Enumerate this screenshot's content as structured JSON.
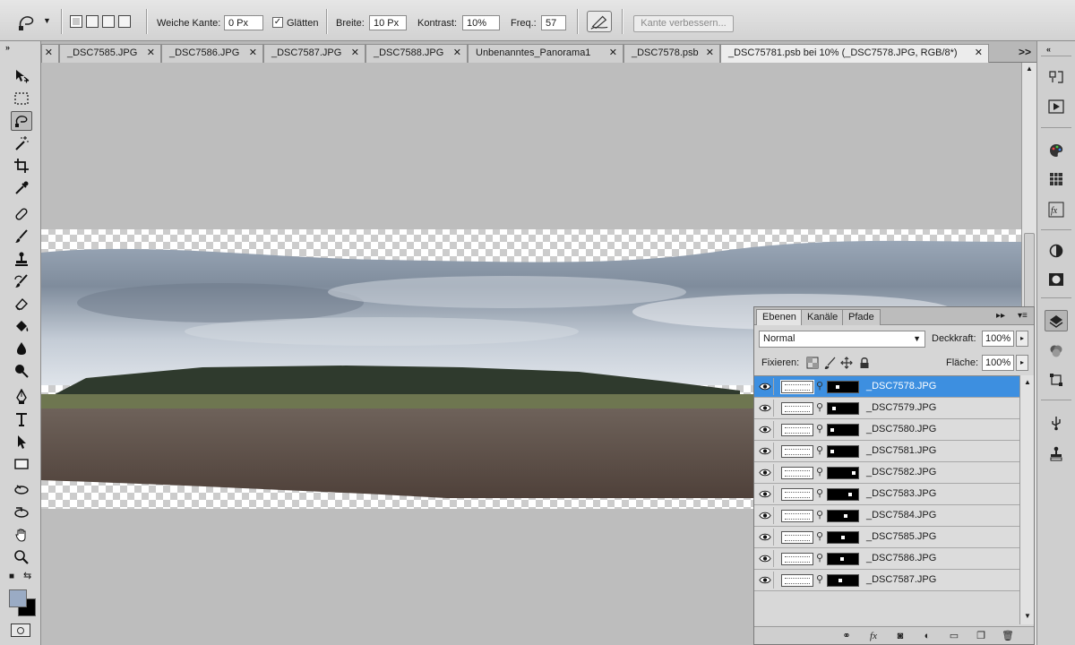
{
  "options_bar": {
    "weiche_kante_label": "Weiche Kante:",
    "weiche_kante_value": "0 Px",
    "glaetten_label": "Glätten",
    "glaetten_checked": true,
    "breite_label": "Breite:",
    "breite_value": "10 Px",
    "kontrast_label": "Kontrast:",
    "kontrast_value": "10%",
    "freq_label": "Freq.:",
    "freq_value": "57",
    "refine_edge_label": "Kante verbessern..."
  },
  "tabs": [
    {
      "label": "_DSC7585.JPG"
    },
    {
      "label": "_DSC7586.JPG"
    },
    {
      "label": "_DSC7587.JPG"
    },
    {
      "label": "_DSC7588.JPG"
    },
    {
      "label": "Unbenanntes_Panorama1"
    },
    {
      "label": "_DSC7578.psb"
    },
    {
      "label": "_DSC75781.psb bei 10% (_DSC7578.JPG, RGB/8*)",
      "active": true
    }
  ],
  "tab_more": ">>",
  "tools": [
    "move-icon",
    "marquee-icon",
    "magnetic-lasso-icon",
    "magic-wand-icon",
    "crop-icon",
    "eyedropper-icon",
    "healing-brush-icon",
    "brush-icon",
    "clone-stamp-icon",
    "history-brush-icon",
    "eraser-icon",
    "paint-bucket-icon",
    "blur-icon",
    "dodge-icon",
    "pen-icon",
    "type-icon",
    "path-selection-icon",
    "rectangle-icon",
    "3d-rotate-icon",
    "3d-orbit-icon",
    "hand-icon",
    "zoom-icon"
  ],
  "colors": {
    "foreground": "#9aabc4",
    "background": "#000000",
    "selection": "#3d8fe0"
  },
  "layers_panel": {
    "tabs": [
      "Ebenen",
      "Kanäle",
      "Pfade"
    ],
    "blend_mode": "Normal",
    "opacity_label": "Deckkraft:",
    "opacity_value": "100%",
    "lock_label": "Fixieren:",
    "fill_label": "Fläche:",
    "fill_value": "100%",
    "layers": [
      {
        "name": "_DSC7578.JPG",
        "selected": true,
        "mask_spot": 0.3
      },
      {
        "name": "_DSC7579.JPG",
        "mask_spot": 0.15
      },
      {
        "name": "_DSC7580.JPG",
        "mask_spot": 0.1
      },
      {
        "name": "_DSC7581.JPG",
        "mask_spot": 0.1
      },
      {
        "name": "_DSC7582.JPG",
        "mask_spot": 0.9
      },
      {
        "name": "_DSC7583.JPG",
        "mask_spot": 0.75
      },
      {
        "name": "_DSC7584.JPG",
        "mask_spot": 0.6
      },
      {
        "name": "_DSC7585.JPG",
        "mask_spot": 0.5
      },
      {
        "name": "_DSC7586.JPG",
        "mask_spot": 0.45
      },
      {
        "name": "_DSC7587.JPG",
        "mask_spot": 0.4
      }
    ]
  }
}
